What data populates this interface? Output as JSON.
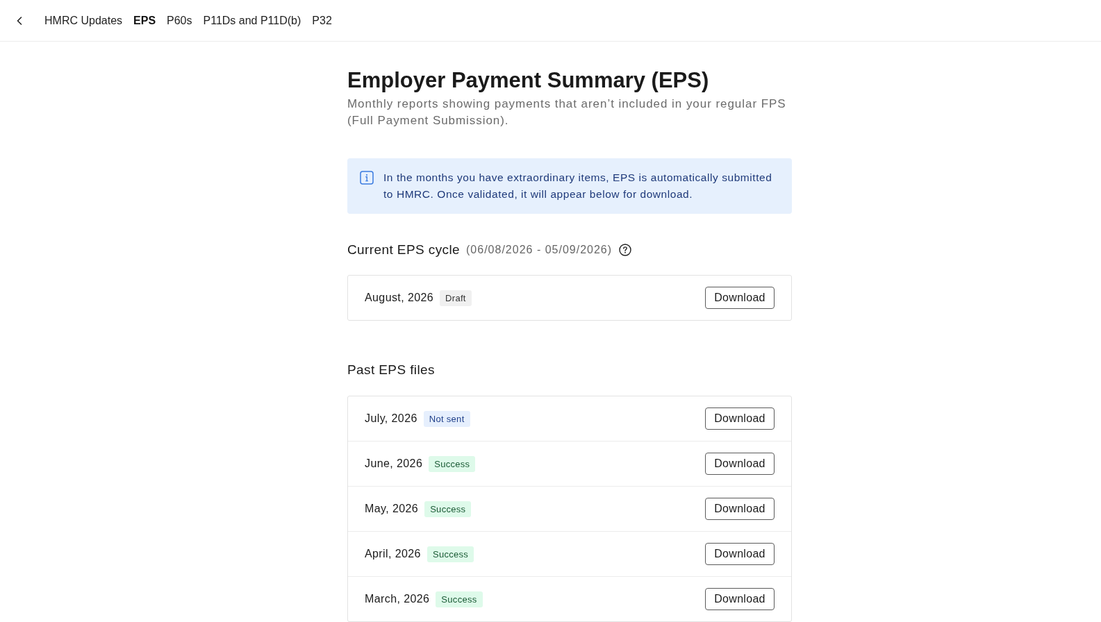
{
  "nav": {
    "tabs": [
      {
        "label": "HMRC Updates",
        "selected": false
      },
      {
        "label": "EPS",
        "selected": true
      },
      {
        "label": "P60s",
        "selected": false
      },
      {
        "label": "P11Ds and P11D(b)",
        "selected": false
      },
      {
        "label": "P32",
        "selected": false
      }
    ]
  },
  "header": {
    "title": "Employer Payment Summary (EPS)",
    "subtitle": "Monthly reports showing payments that aren’t included in your regular FPS (Full Payment Submission)."
  },
  "info_banner": {
    "text": "In the months you have extraordinary items, EPS is automatically submitted to HMRC. Once validated, it will appear below for download."
  },
  "current_cycle": {
    "heading": "Current EPS cycle",
    "period": "(06/08/2026 - 05/09/2026)",
    "items": [
      {
        "month": "August, 2026",
        "status": {
          "label": "Draft",
          "kind": "draft"
        },
        "action": "Download"
      }
    ]
  },
  "past_files": {
    "heading": "Past EPS files",
    "items": [
      {
        "month": "July, 2026",
        "status": {
          "label": "Not sent",
          "kind": "not_sent"
        },
        "action": "Download"
      },
      {
        "month": "June, 2026",
        "status": {
          "label": "Success",
          "kind": "success"
        },
        "action": "Download"
      },
      {
        "month": "May, 2026",
        "status": {
          "label": "Success",
          "kind": "success"
        },
        "action": "Download"
      },
      {
        "month": "April, 2026",
        "status": {
          "label": "Success",
          "kind": "success"
        },
        "action": "Download"
      },
      {
        "month": "March, 2026",
        "status": {
          "label": "Success",
          "kind": "success"
        },
        "action": "Download"
      }
    ]
  }
}
